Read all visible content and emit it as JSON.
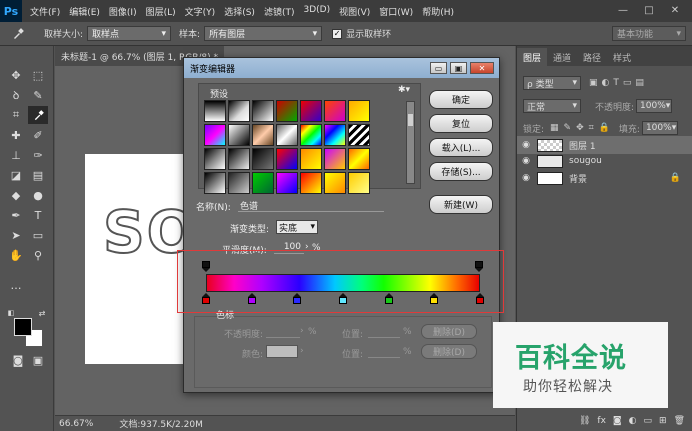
{
  "app": {
    "logo": "Ps"
  },
  "menu": [
    "文件(F)",
    "编辑(E)",
    "图像(I)",
    "图层(L)",
    "文字(Y)",
    "选择(S)",
    "滤镜(T)",
    "3D(D)",
    "视图(V)",
    "窗口(W)",
    "帮助(H)"
  ],
  "window_controls": {
    "minimize": "—",
    "restore": "□",
    "close": "✕"
  },
  "options_bar": {
    "tool_icon": "eyedropper-icon",
    "sample_size_label": "取样大小:",
    "sample_size_value": "取样点",
    "sample_label": "样本:",
    "sample_value": "所有图层",
    "show_ring_label": "显示取样环",
    "show_ring_checked": "✓",
    "workspace": "基本功能"
  },
  "document": {
    "tab_title": "未标题-1 @ 66.7% (图层 1, RGB/8) *",
    "canvas_text": "SO",
    "zoom": "66.67%",
    "doc_size": "文档:937.5K/2.20M"
  },
  "layers_panel": {
    "tabs": [
      "图层",
      "通道",
      "路径",
      "样式"
    ],
    "filter_kind": "ρ 类型",
    "blend_mode": "正常",
    "opacity_label": "不透明度:",
    "opacity_value": "100%",
    "lock_label": "锁定:",
    "fill_label": "填充:",
    "fill_value": "100%",
    "layers": [
      {
        "name": "图层 1",
        "selected": true
      },
      {
        "name": "sougou",
        "selected": false
      },
      {
        "name": "背景",
        "selected": false
      }
    ],
    "footer_icons": [
      "link-icon",
      "fx-icon",
      "mask-icon",
      "adjustment-icon",
      "folder-icon",
      "new-layer-icon",
      "trash-icon"
    ],
    "fx_label": "fx"
  },
  "gradient_editor": {
    "title": "渐变编辑器",
    "presets_label": "预设",
    "buttons": {
      "ok": "确定",
      "reset": "复位",
      "load": "载入(L)...",
      "save": "存储(S)...",
      "new": "新建(W)"
    },
    "name_label": "名称(N):",
    "name_value": "色谱",
    "gradient_type_label": "渐变类型:",
    "gradient_type_value": "实底",
    "smoothness_label": "平滑度(M):",
    "smoothness_value": "100",
    "smoothness_unit": "%",
    "stops_group_label": "色标",
    "opacity_label": "不透明度:",
    "location_label": "位置:",
    "delete_label": "删除(D)",
    "color_label": "颜色:",
    "percent_unit": "%",
    "color_stops": [
      "#e00000",
      "#b000ff",
      "#2a2aff",
      "#60e8ff",
      "#18c818",
      "#ffe000",
      "#e00000"
    ]
  },
  "watermark": {
    "main": "百科全说",
    "sub": "助你轻松解决"
  }
}
